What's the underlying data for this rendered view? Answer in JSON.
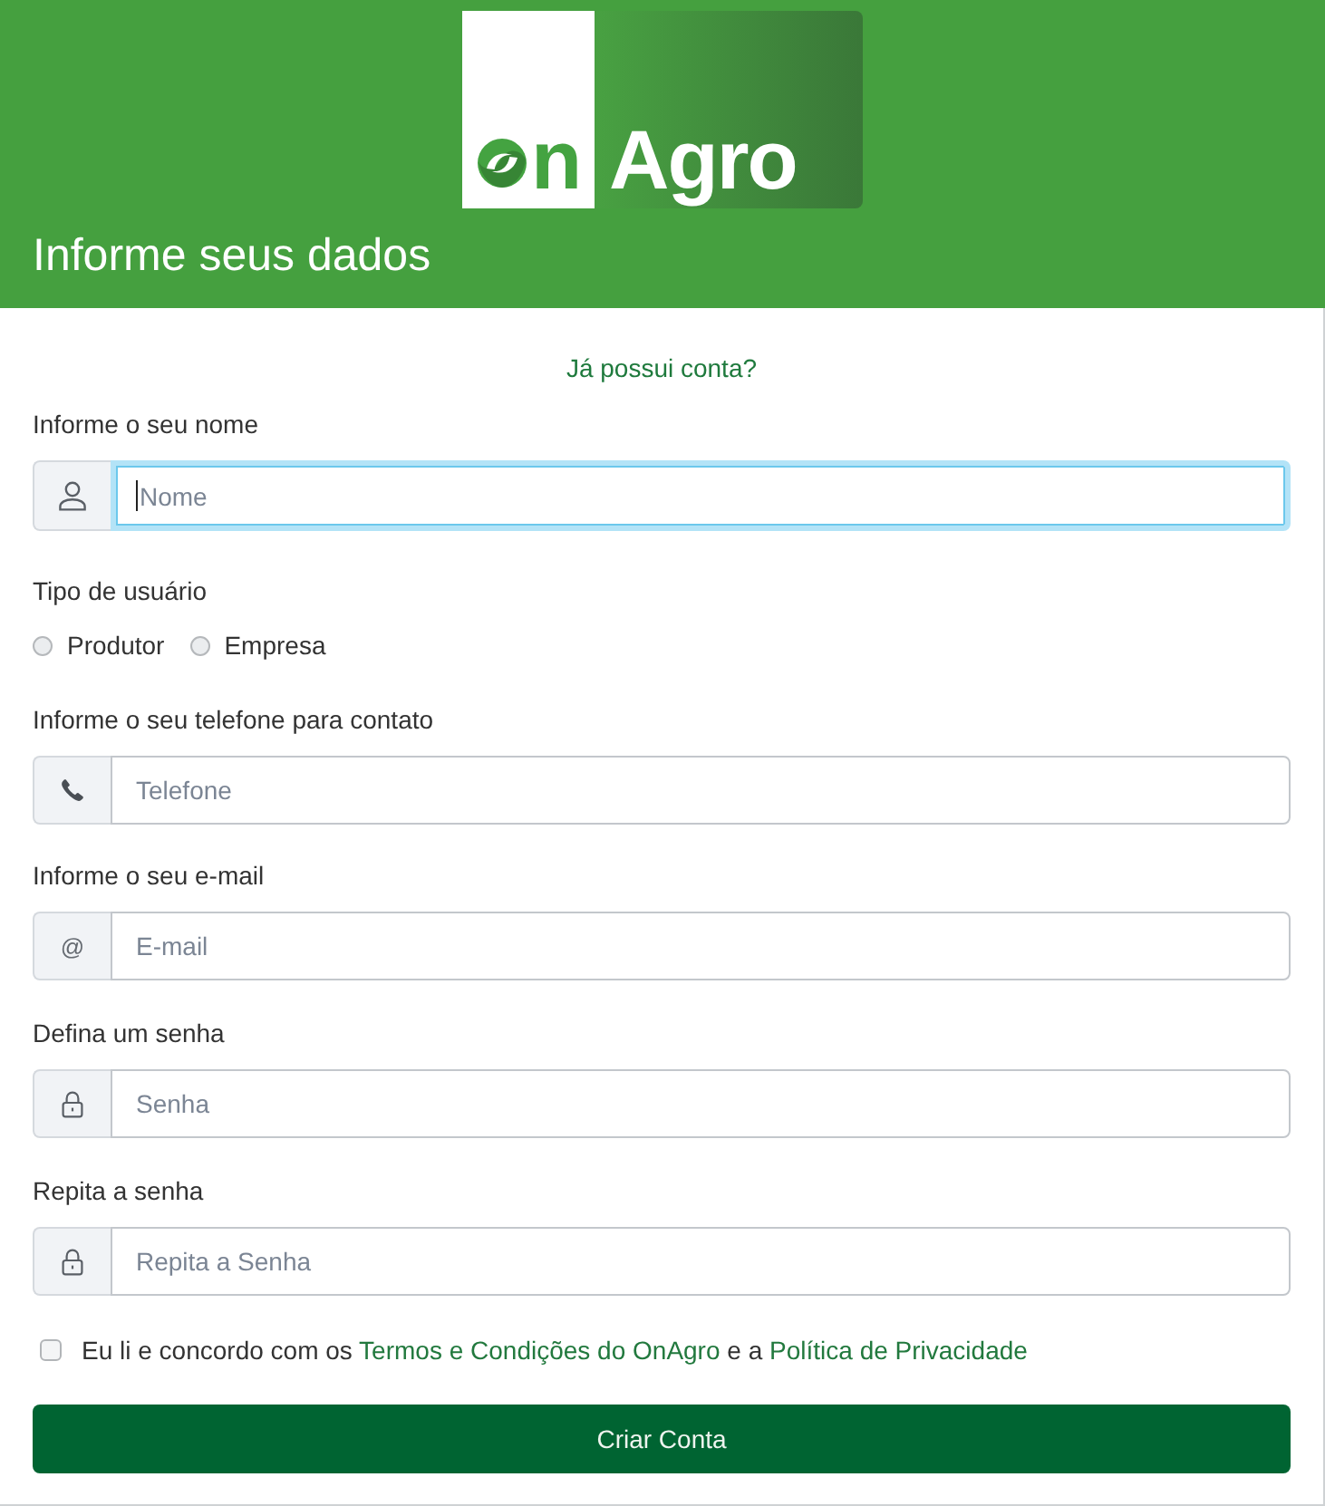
{
  "header": {
    "logo": {
      "tile_text": "n",
      "banner_text": "Agro"
    },
    "title": "Informe seus dados"
  },
  "form": {
    "login_link": "Já possui conta?",
    "name_field": {
      "kind": "name",
      "label": "Informe o seu nome",
      "placeholder": "Nome",
      "focused": true
    },
    "user_type": {
      "label": "Tipo de usuário",
      "options": [
        {
          "label": "Produtor",
          "selected": false
        },
        {
          "label": "Empresa",
          "selected": false
        }
      ]
    },
    "fields": [
      {
        "kind": "phone",
        "label": "Informe o seu telefone para contato",
        "placeholder": "Telefone",
        "focused": false
      },
      {
        "kind": "email",
        "label": "Informe o seu e-mail",
        "addon_text": "@",
        "placeholder": "E-mail",
        "focused": false
      },
      {
        "kind": "password",
        "label": "Defina um senha",
        "placeholder": "Senha",
        "focused": false
      },
      {
        "kind": "password",
        "label": "Repita a senha",
        "placeholder": "Repita a Senha",
        "focused": false
      }
    ],
    "agreement": {
      "checked": false,
      "parts": [
        {
          "kind": "text",
          "text": "Eu li e concordo com os "
        },
        {
          "kind": "link",
          "text": "Termos e Condições do OnAgro"
        },
        {
          "kind": "text",
          "text": " e a "
        },
        {
          "kind": "link",
          "text": "Política de Privacidade"
        }
      ]
    },
    "submit_button": "Criar Conta"
  }
}
